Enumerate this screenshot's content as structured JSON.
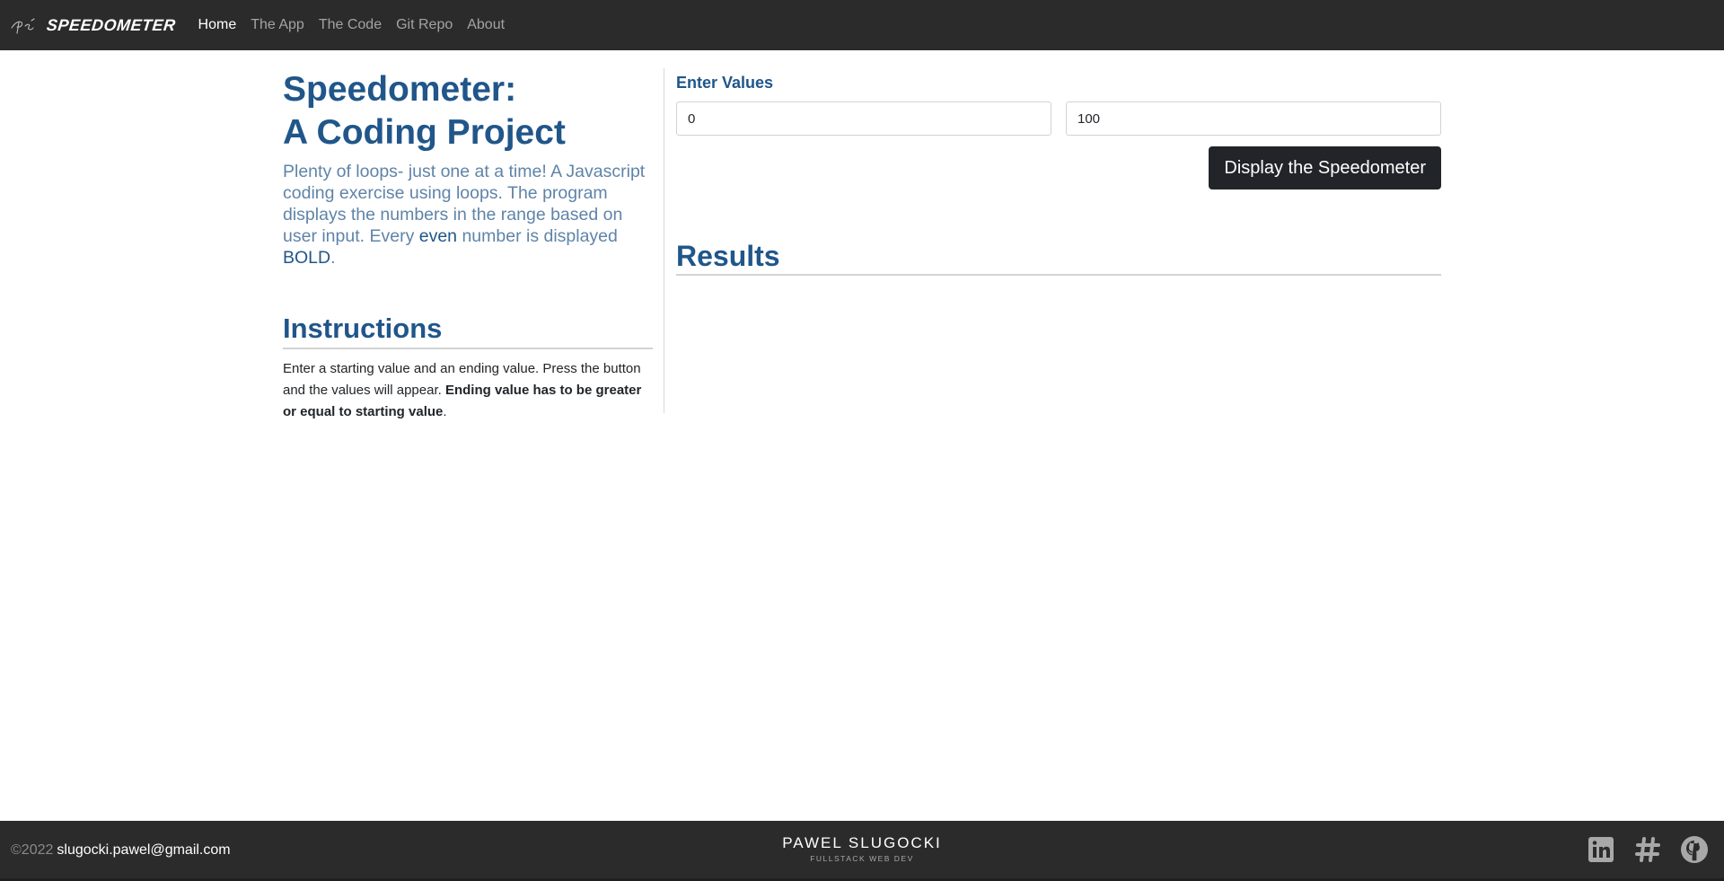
{
  "navbar": {
    "brand": "SPEEDOMETER",
    "logo_icon": "ps-signature-logo",
    "links": [
      {
        "label": "Home",
        "active": true
      },
      {
        "label": "The App",
        "active": false
      },
      {
        "label": "The Code",
        "active": false
      },
      {
        "label": "Git Repo",
        "active": false
      },
      {
        "label": "About",
        "active": false
      }
    ]
  },
  "intro": {
    "title_line1": "Speedometer:",
    "title_line2": "A Coding Project",
    "lead_part1": "Plenty of loops- just one at a time! A Javascript coding exercise using loops. The program displays the numbers in the range based on user input. Every ",
    "lead_even": "even",
    "lead_part2": " number is displayed ",
    "lead_bold": "BOLD",
    "lead_end": "."
  },
  "instructions": {
    "title": "Instructions",
    "text": "Enter a starting value and an ending value. Press the button and the values will appear. ",
    "bold_text": "Ending value has to be greater or equal to starting value",
    "end": "."
  },
  "form": {
    "label": "Enter Values",
    "start_value": "0",
    "end_value": "100",
    "button_label": "Display the Speedometer"
  },
  "results": {
    "title": "Results"
  },
  "footer": {
    "copyright": "©2022",
    "email": "slugocki.pawel@gmail.com",
    "name": "PAWEL SLUGOCKI",
    "subtitle": "FULLSTACK WEB DEV",
    "socials": [
      "linkedin-icon",
      "hashtag-icon",
      "github-icon"
    ]
  },
  "colors": {
    "navbar_bg": "#2b2b2b",
    "heading_blue": "#20568a",
    "lead_blue": "#5f84a8",
    "button_dark": "#212529"
  }
}
